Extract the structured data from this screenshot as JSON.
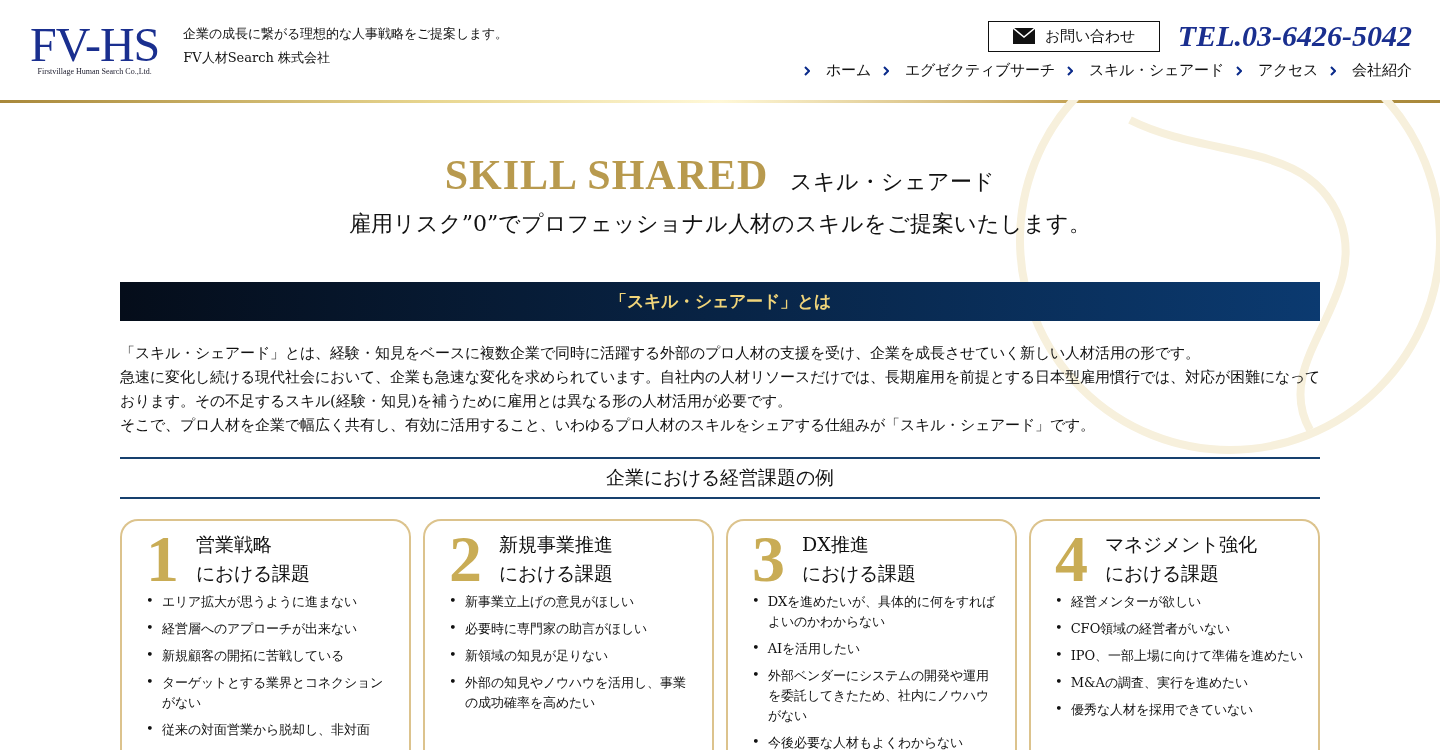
{
  "header": {
    "logo": "FV-HS",
    "logo_subtitle": "Firstvillage Human Search Co.,Ltd.",
    "tagline": "企業の成長に繋がる理想的な人事戦略をご提案します。",
    "company": "FV人材Search 株式会社",
    "contact_button": "お問い合わせ",
    "phone": "TEL.03-6426-5042",
    "nav": [
      "ホーム",
      "エグゼクティブサーチ",
      "スキル・シェアード",
      "アクセス",
      "会社紹介"
    ]
  },
  "hero": {
    "title_en": "SKILL SHARED",
    "title_ja": "スキル・シェアード",
    "subtitle": "雇用リスク”0”でプロフェッショナル人材のスキルをご提案いたします。"
  },
  "section_heading": "「スキル・シェアード」とは",
  "description": [
    "「スキル・シェアード」とは、経験・知見をベースに複数企業で同時に活躍する外部のプロ人材の支援を受け、企業を成長させていく新しい人材活用の形です。",
    "急速に変化し続ける現代社会において、企業も急速な変化を求められています。自社内の人材リソースだけでは、長期雇用を前提とする日本型雇用慣行では、対応が困難になっております。その不足するスキル(経験・知見)を補うために雇用とは異なる形の人材活用が必要です。",
    "そこで、プロ人材を企業で幅広く共有し、有効に活用すること、いわゆるプロ人材のスキルをシェアする仕組みが「スキル・シェアード」です。"
  ],
  "examples_heading": "企業における経営課題の例",
  "bullet": "•",
  "cards": [
    {
      "number": "1",
      "title": [
        "営業戦略",
        "における課題"
      ],
      "items": [
        "エリア拡大が思うように進まない",
        "経営層へのアプローチが出来ない",
        "新規顧客の開拓に苦戦している",
        "ターゲットとする業界とコネクションがない",
        "従来の対面営業から脱却し、非対面"
      ]
    },
    {
      "number": "2",
      "title": [
        "新規事業推進",
        "における課題"
      ],
      "items": [
        "新事業立上げの意見がほしい",
        "必要時に専門家の助言がほしい",
        "新領域の知見が足りない",
        "外部の知見やノウハウを活用し、事業の成功確率を高めたい"
      ]
    },
    {
      "number": "3",
      "title": [
        "DX推進",
        "における課題"
      ],
      "items": [
        "DXを進めたいが、具体的に何をすればよいのかわからない",
        "AIを活用したい",
        "外部ベンダーにシステムの開発や運用を委託してきたため、社内にノウハウがない",
        "今後必要な人材もよくわからない"
      ]
    },
    {
      "number": "4",
      "title": [
        "マネジメント強化",
        "における課題"
      ],
      "items": [
        "経営メンターが欲しい",
        "CFO領域の経営者がいない",
        "IPO、一部上場に向けて準備を進めたい",
        "M&Aの調査、実行を進めたい",
        "優秀な人材を採用できていない"
      ]
    }
  ]
}
